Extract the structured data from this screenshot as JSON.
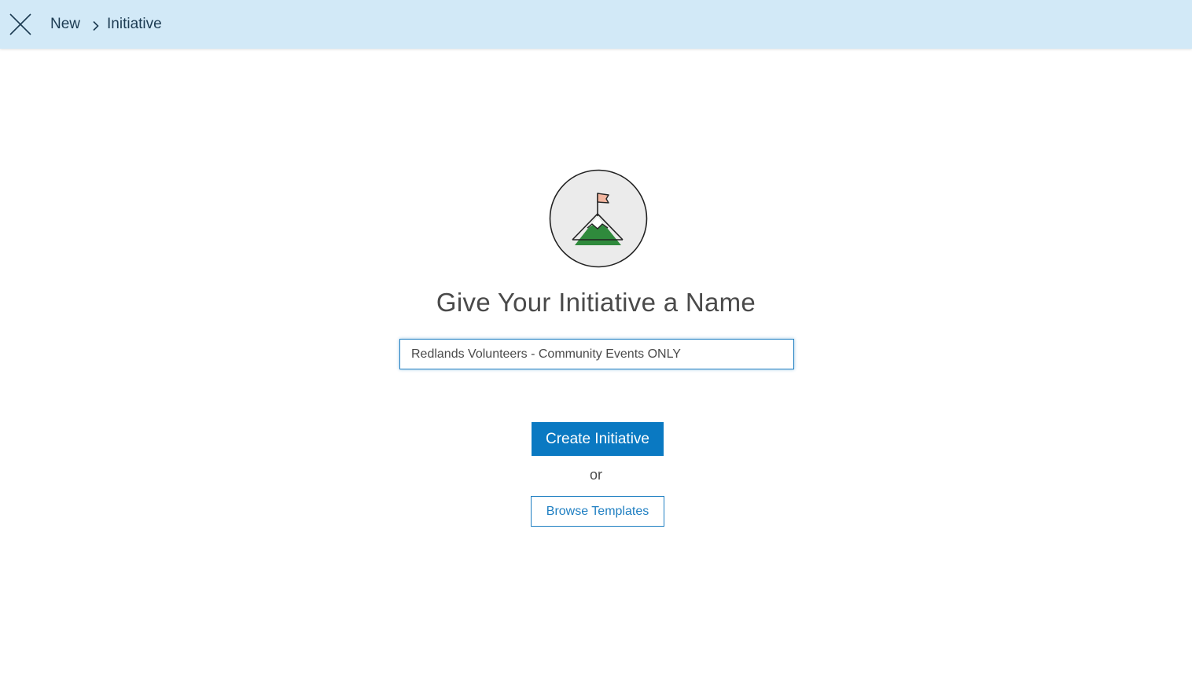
{
  "header": {
    "close_icon": "close-icon",
    "breadcrumb": {
      "parent": "New",
      "separator_icon": "chevron-right-icon",
      "current": "Initiative"
    }
  },
  "main": {
    "hero_icon": "mountain-flag-icon",
    "title": "Give Your Initiative a Name",
    "name_input": {
      "value": "Redlands Volunteers - Community Events ONLY ",
      "placeholder": ""
    },
    "create_button": "Create Initiative",
    "or_text": "or",
    "browse_button": "Browse Templates"
  },
  "colors": {
    "header_bg": "#d2e9f7",
    "primary": "#0a79c2",
    "text": "#4a4a4a",
    "mountain_green": "#2f8a3c",
    "flag": "#f2b6a0"
  }
}
